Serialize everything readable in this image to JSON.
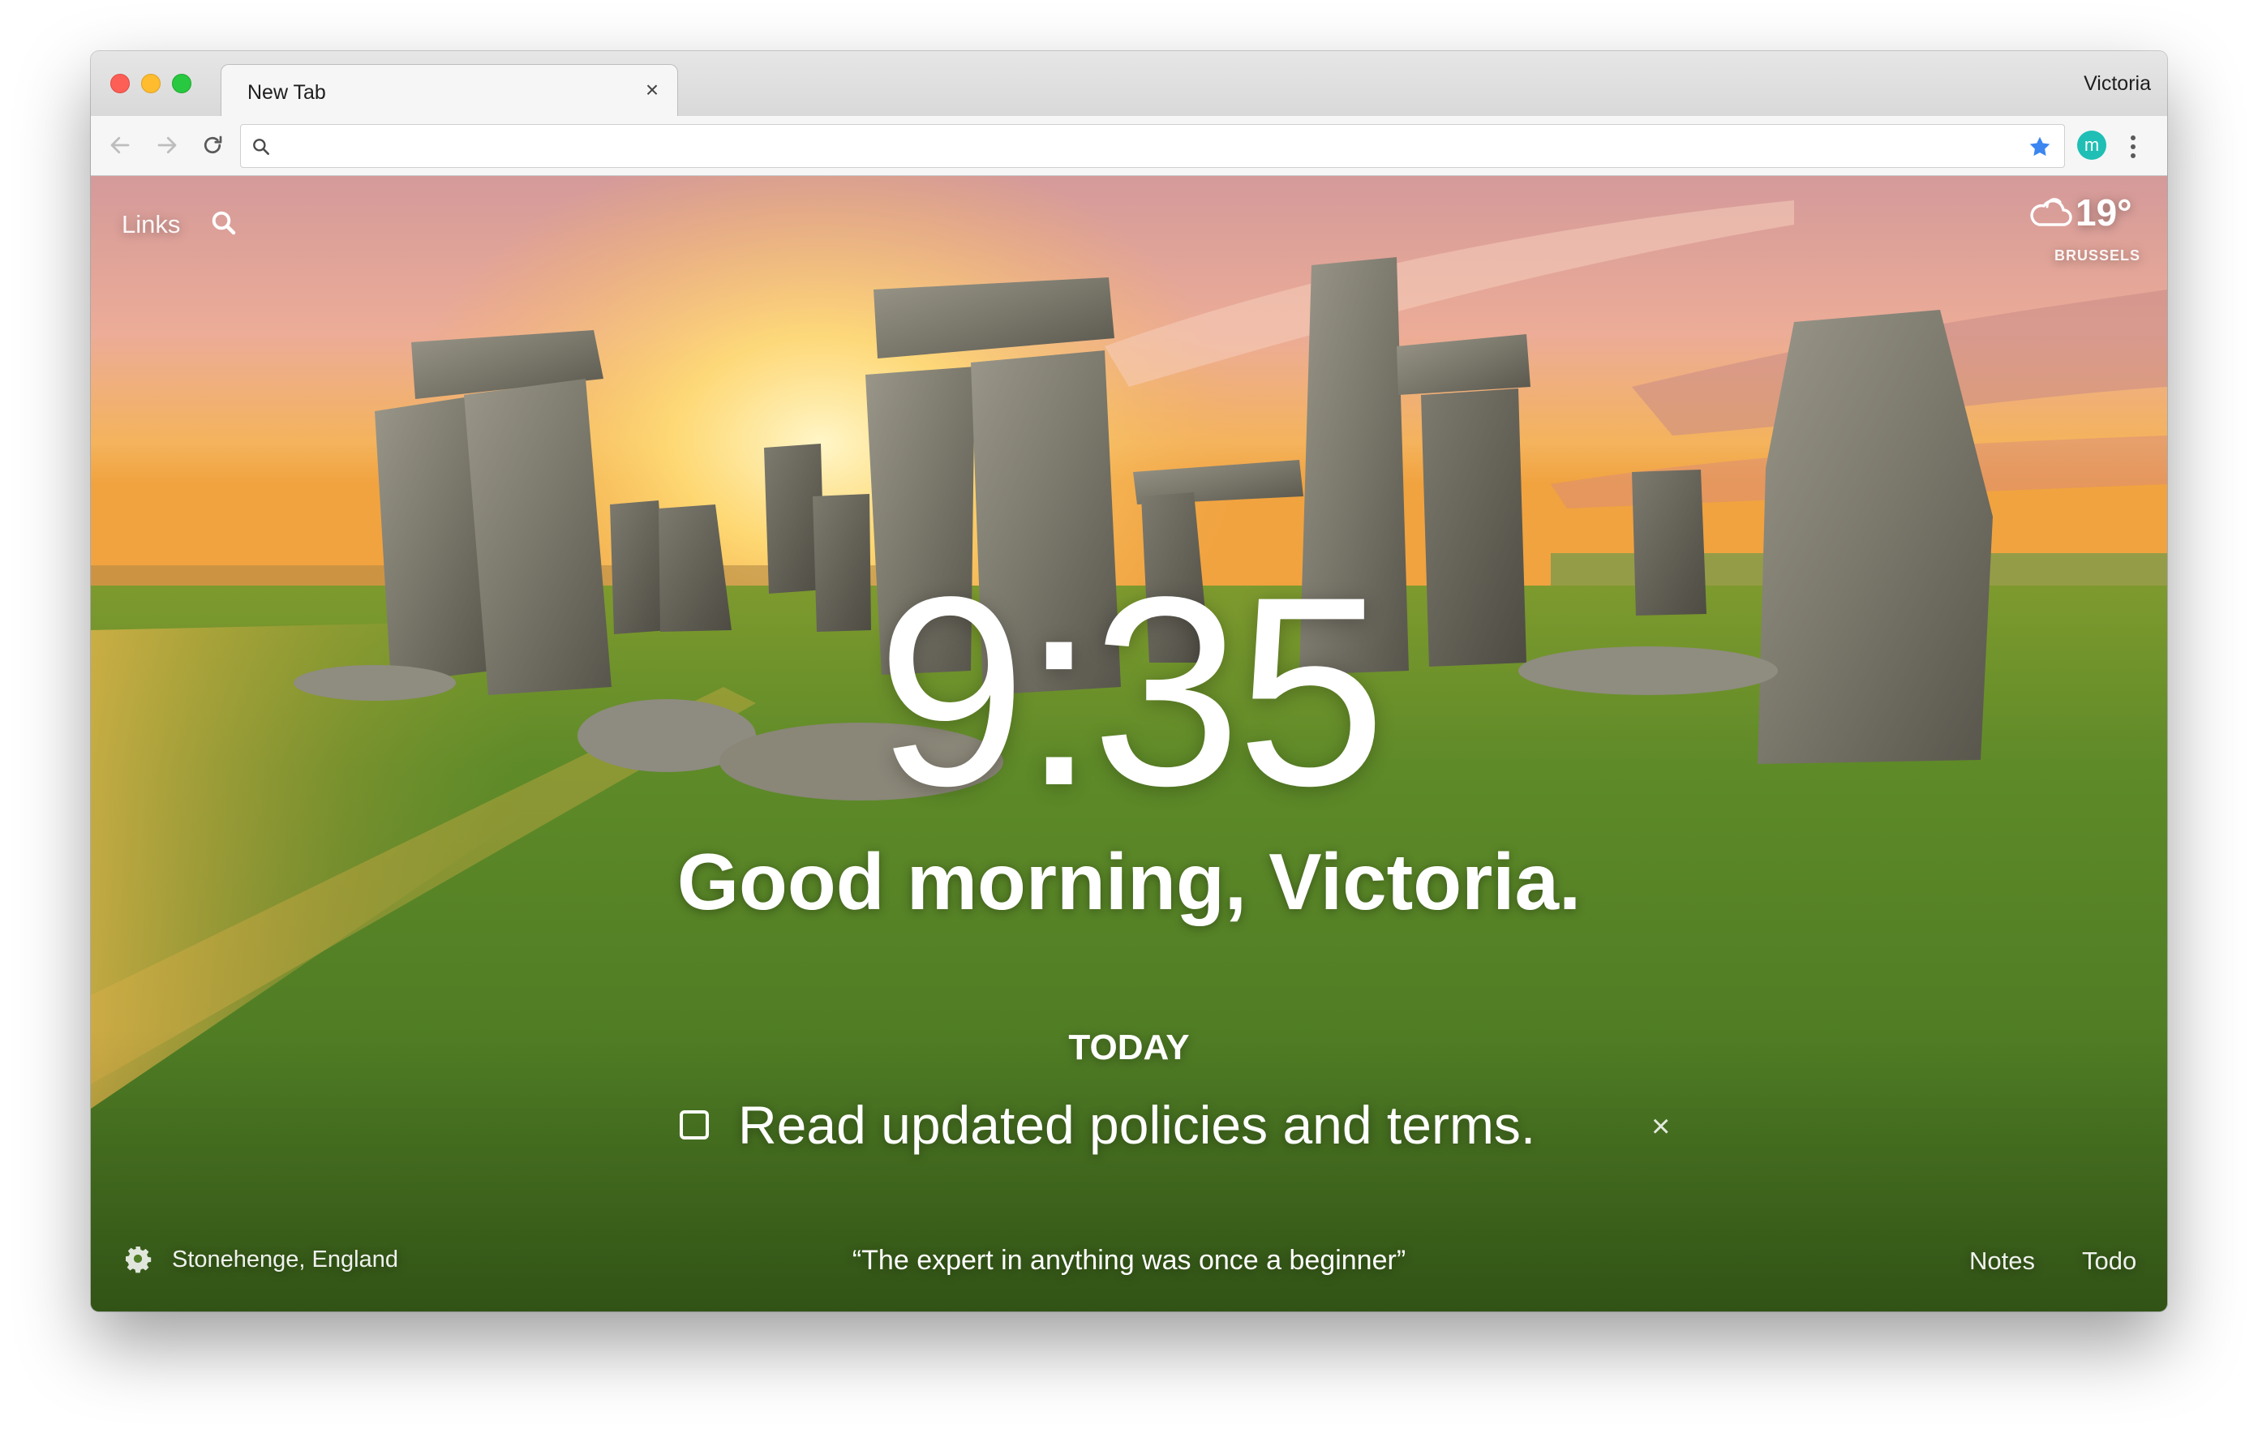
{
  "browser": {
    "tab_title": "New Tab",
    "tab_close": "×",
    "profile_name": "Victoria",
    "address_value": "",
    "extension_letter": "m",
    "accent_star": "#3b86f0",
    "extension_color": "#1fbfb5"
  },
  "icons": {
    "back": "back-arrow-icon",
    "forward": "forward-arrow-icon",
    "reload": "reload-icon",
    "omnibox_search": "search-icon",
    "bookmark": "star-icon",
    "menu": "kebab-menu-icon",
    "top_search": "search-icon",
    "weather": "cloud-icon",
    "settings": "gear-icon"
  },
  "momentum": {
    "links_label": "Links",
    "weather": {
      "temperature": "19°",
      "city": "BRUSSELS"
    },
    "clock": "9:35",
    "greeting": "Good morning, Victoria.",
    "focus_heading": "TODAY",
    "focus_task": "Read updated policies and terms.",
    "focus_task_done": false,
    "focus_delete": "×",
    "location": "Stonehenge, England",
    "quote": "“The expert in anything was once a beginner”",
    "notes_label": "Notes",
    "todo_label": "Todo"
  }
}
